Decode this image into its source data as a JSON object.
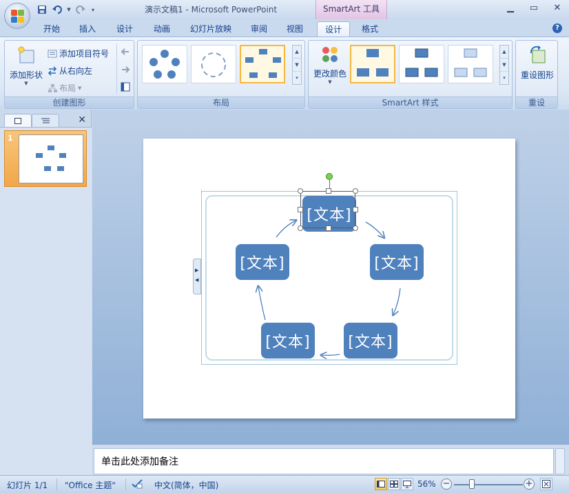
{
  "window": {
    "title": "演示文稿1 - Microsoft PowerPoint",
    "context_title": "SmartArt 工具"
  },
  "tabs": [
    {
      "label": "开始"
    },
    {
      "label": "插入"
    },
    {
      "label": "设计"
    },
    {
      "label": "动画"
    },
    {
      "label": "幻灯片放映"
    },
    {
      "label": "审阅"
    },
    {
      "label": "视图"
    },
    {
      "label": "设计"
    },
    {
      "label": "格式"
    }
  ],
  "ribbon": {
    "create_group": {
      "label": "创建图形",
      "add_shape": "添加形状",
      "add_bullet": "添加项目符号",
      "right_to_left": "从右向左",
      "layout": "布局"
    },
    "layout_group": {
      "label": "布局"
    },
    "style_group": {
      "label": "SmartArt 样式",
      "change_colors": "更改颜色"
    },
    "reset_group": {
      "label": "重设",
      "reset_graphic": "重设图形"
    }
  },
  "slide": {
    "number": "1",
    "nodes": [
      {
        "text": "[文本]"
      },
      {
        "text": "[文本]"
      },
      {
        "text": "[文本]"
      },
      {
        "text": "[文本]"
      },
      {
        "text": "[文本]"
      }
    ]
  },
  "notes": {
    "placeholder": "单击此处添加备注"
  },
  "status": {
    "slide_info": "幻灯片 1/1",
    "theme": "\"Office 主题\"",
    "language": "中文(简体，中国)",
    "zoom": "56%"
  },
  "colors": {
    "node_fill": "#4f81bd",
    "selected_thumb": "#f2a64a",
    "rotate_handle": "#7dd34f"
  }
}
